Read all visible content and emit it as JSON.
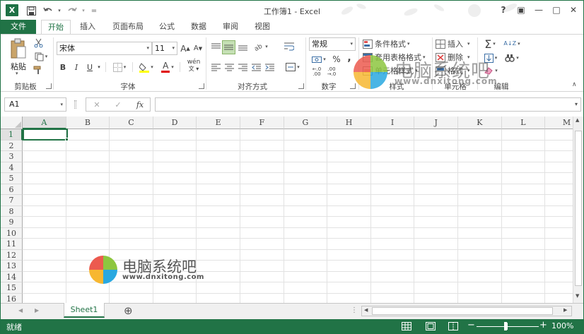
{
  "window": {
    "title": "工作簿1 - Excel",
    "logo_letter": "X",
    "controls": [
      "?",
      "▣",
      "—",
      "□",
      "✕"
    ]
  },
  "quick_access": {
    "save_icon": "save-icon",
    "undo_icon": "undo-icon",
    "redo_icon": "redo-icon",
    "customize": "="
  },
  "tabs": [
    "文件",
    "开始",
    "插入",
    "页面布局",
    "公式",
    "数据",
    "审阅",
    "视图"
  ],
  "ribbon": {
    "clipboard": {
      "paste": "粘贴",
      "label": "剪贴板"
    },
    "font": {
      "name": "宋体",
      "size": "11",
      "grow": "A",
      "shrink": "A",
      "bold": "B",
      "italic": "I",
      "underline": "U",
      "font_color_letter": "A",
      "phonetic": "wén",
      "label": "字体"
    },
    "alignment": {
      "label": "对齐方式"
    },
    "number": {
      "format": "常规",
      "percent": "%",
      "comma": ",",
      "label": "数字",
      "inc_decimal": "←.0\n.00",
      "dec_decimal": ".00\n→.0"
    },
    "styles": {
      "conditional": "条件格式",
      "table": "套用表格格式",
      "cell_styles": "单元格样式",
      "label": "样式"
    },
    "cells": {
      "insert": "插入",
      "delete": "删除",
      "format": "格式",
      "label": "单元格"
    },
    "editing": {
      "sum": "Σ",
      "sort": "A↓Z",
      "label": "编辑"
    }
  },
  "formula_bar": {
    "name_box": "A1",
    "cancel": "✕",
    "enter": "✓",
    "fx": "fx",
    "value": ""
  },
  "columns": [
    "A",
    "B",
    "C",
    "D",
    "E",
    "F",
    "G",
    "H",
    "I",
    "J",
    "K",
    "L",
    "M"
  ],
  "rows": [
    "1",
    "2",
    "3",
    "4",
    "5",
    "6",
    "7",
    "8",
    "9",
    "10",
    "11",
    "12",
    "13",
    "14",
    "15",
    "16"
  ],
  "sheet_tabs": {
    "active": "Sheet1",
    "add": "⊕"
  },
  "status": {
    "ready": "就绪",
    "zoom": "100%",
    "minus": "−",
    "plus": "+"
  },
  "watermark": {
    "brand": "电脑系统吧",
    "url": "www.dnxitong.com"
  },
  "colors": {
    "accent": "#217346",
    "accent_border": "#1e7145"
  }
}
